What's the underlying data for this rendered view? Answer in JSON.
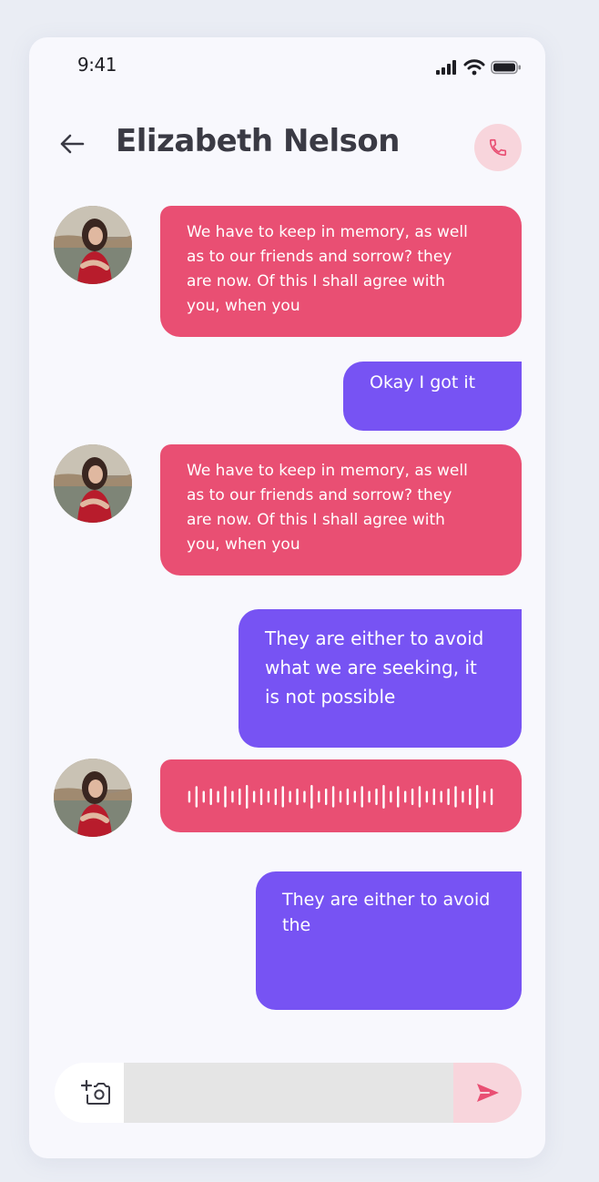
{
  "status_bar": {
    "time": "9:41",
    "icons": [
      "signal-icon",
      "wifi-icon",
      "battery-icon"
    ]
  },
  "header": {
    "back_icon": "arrow-left-icon",
    "contact_name": "Elizabeth Nelson",
    "call_icon": "phone-icon"
  },
  "messages": [
    {
      "direction": "incoming",
      "type": "text",
      "text": "We have to keep in memory, as well\nas to our friends and sorrow? they\nare now. Of this I shall agree with\nyou, when you"
    },
    {
      "direction": "outgoing",
      "type": "text",
      "text": "Okay I got it"
    },
    {
      "direction": "incoming",
      "type": "text",
      "text": "We have to keep in memory, as well\nas to our friends and sorrow? they\nare now. Of this I shall agree with\nyou, when you"
    },
    {
      "direction": "outgoing",
      "type": "text",
      "text": "They are either to avoid\nwhat we are seeking, it\nis not possible"
    },
    {
      "direction": "incoming",
      "type": "voice",
      "waveform": [
        0.5,
        0.9,
        0.5,
        0.7,
        0.5,
        0.9,
        0.5,
        0.7,
        1.0,
        0.5,
        0.7,
        0.5,
        0.7,
        0.9,
        0.5,
        0.7,
        0.5,
        1.0,
        0.5,
        0.7,
        0.9,
        0.5,
        0.7,
        0.5,
        0.9,
        0.5,
        0.7,
        1.0,
        0.5,
        0.9,
        0.5,
        0.7,
        0.9,
        0.5,
        0.7,
        0.5,
        0.7,
        0.9,
        0.5,
        0.7,
        1.0,
        0.5,
        0.7
      ]
    },
    {
      "direction": "outgoing",
      "type": "text",
      "text": "They are either to avoid\nthe"
    }
  ],
  "composer": {
    "camera_icon": "add-photo-icon",
    "input_value": "",
    "input_placeholder": "",
    "send_icon": "send-icon"
  },
  "colors": {
    "incoming_bubble": "#e94f73",
    "outgoing_bubble": "#7753f3",
    "call_button_bg": "#f8d5dc",
    "send_button_bg": "#f8d5dc",
    "accent_icon": "#e94f73"
  }
}
